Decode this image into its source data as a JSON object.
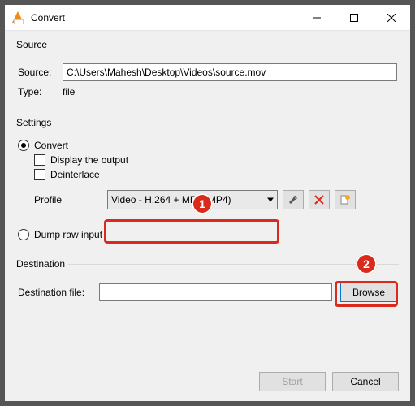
{
  "window": {
    "title": "Convert"
  },
  "source": {
    "legend": "Source",
    "label": "Source:",
    "path": "C:\\Users\\Mahesh\\Desktop\\Videos\\source.mov",
    "type_label": "Type:",
    "type_value": "file"
  },
  "settings": {
    "legend": "Settings",
    "convert_label": "Convert",
    "display_label": "Display the output",
    "deinterlace_label": "Deinterlace",
    "profile_label": "Profile",
    "profile_value": "Video - H.264 + MP3 (MP4)",
    "dump_label": "Dump raw input"
  },
  "destination": {
    "legend": "Destination",
    "label": "Destination file:",
    "value": "",
    "browse_label": "Browse"
  },
  "footer": {
    "start_label": "Start",
    "cancel_label": "Cancel"
  },
  "annotations": {
    "badge1": "1",
    "badge2": "2"
  }
}
